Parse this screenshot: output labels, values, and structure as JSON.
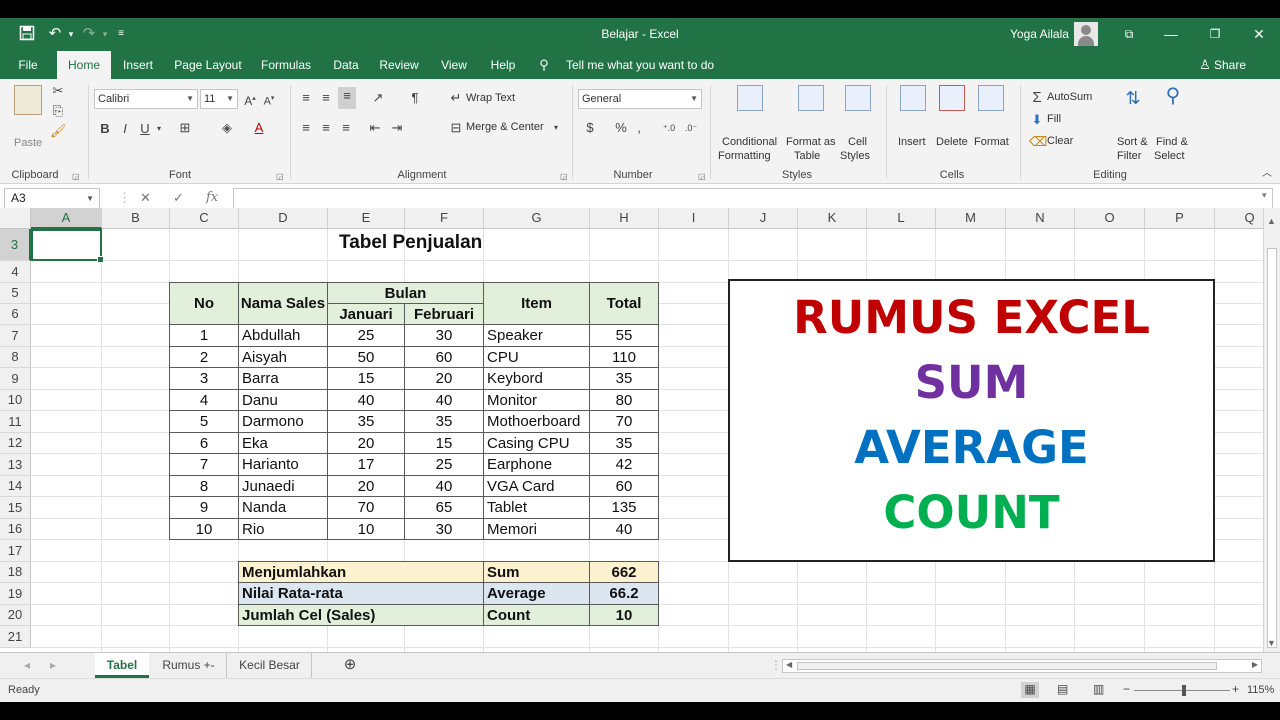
{
  "window": {
    "title": "Belajar  -  Excel",
    "user": "Yoga Ailala",
    "brand_color": "#217346"
  },
  "menu": {
    "tabs": [
      "File",
      "Home",
      "Insert",
      "Page Layout",
      "Formulas",
      "Data",
      "Review",
      "View",
      "Help"
    ],
    "active_tab": "Home",
    "tell_me": "Tell me what you want to do",
    "share": "Share"
  },
  "ribbon": {
    "clipboard": {
      "label": "Clipboard",
      "paste": "Paste"
    },
    "font": {
      "label": "Font",
      "name": "Calibri",
      "size": "11",
      "bold": "B",
      "italic": "I",
      "underline": "U"
    },
    "alignment": {
      "label": "Alignment",
      "wrap_text": "Wrap Text",
      "merge_center": "Merge & Center"
    },
    "number": {
      "label": "Number",
      "format": "General",
      "currency": "$",
      "percent": "%",
      "comma": ","
    },
    "styles": {
      "label": "Styles",
      "conditional_1": "Conditional",
      "conditional_2": "Formatting",
      "format_as_1": "Format as",
      "format_as_2": "Table",
      "cell_styles_1": "Cell",
      "cell_styles_2": "Styles"
    },
    "cells": {
      "label": "Cells",
      "insert": "Insert",
      "delete": "Delete",
      "format": "Format"
    },
    "editing": {
      "label": "Editing",
      "autosum": "AutoSum",
      "fill": "Fill",
      "clear": "Clear",
      "sort_1": "Sort &",
      "sort_2": "Filter",
      "find_1": "Find &",
      "find_2": "Select"
    }
  },
  "formula_bar": {
    "name_box": "A3",
    "formula": ""
  },
  "columns": [
    "A",
    "B",
    "C",
    "D",
    "E",
    "F",
    "G",
    "H",
    "I",
    "J",
    "K",
    "L",
    "M",
    "N",
    "O",
    "P",
    "Q"
  ],
  "rows": [
    "3",
    "4",
    "5",
    "6",
    "7",
    "8",
    "9",
    "10",
    "11",
    "12",
    "13",
    "14",
    "15",
    "16",
    "17",
    "18",
    "19",
    "20",
    "21"
  ],
  "selected_cell": "A3",
  "sheet": {
    "title": "Tabel Penjualan",
    "headers": {
      "no": "No",
      "nama": "Nama Sales",
      "bulan": "Bulan",
      "januari": "Januari",
      "februari": "Februari",
      "item": "Item",
      "total": "Total"
    },
    "table": [
      [
        "1",
        "Abdullah",
        "25",
        "30",
        "Speaker",
        "55"
      ],
      [
        "2",
        "Aisyah",
        "50",
        "60",
        "CPU",
        "110"
      ],
      [
        "3",
        "Barra",
        "15",
        "20",
        "Keybord",
        "35"
      ],
      [
        "4",
        "Danu",
        "40",
        "40",
        "Monitor",
        "80"
      ],
      [
        "5",
        "Darmono",
        "35",
        "35",
        "Mothoerboard",
        "70"
      ],
      [
        "6",
        "Eka",
        "20",
        "15",
        "Casing CPU",
        "35"
      ],
      [
        "7",
        "Harianto",
        "17",
        "25",
        "Earphone",
        "42"
      ],
      [
        "8",
        "Junaedi",
        "20",
        "40",
        "VGA Card",
        "60"
      ],
      [
        "9",
        "Nanda",
        "70",
        "65",
        "Tablet",
        "135"
      ],
      [
        "10",
        "Rio",
        "10",
        "30",
        "Memori",
        "40"
      ]
    ],
    "summary": [
      {
        "label": "Menjumlahkan",
        "func": "Sum",
        "value": "662",
        "color": "#fdf2d0"
      },
      {
        "label": "Nilai Rata-rata",
        "func": "Average",
        "value": "66.2",
        "color": "#dce6f1"
      },
      {
        "label": "Jumlah Cel (Sales)",
        "func": "Count",
        "value": "10",
        "color": "#e2efda"
      }
    ],
    "header_color": "#e2efda",
    "rumus_box": [
      {
        "text": "RUMUS EXCEL",
        "color": "#c00000"
      },
      {
        "text": "SUM",
        "color": "#7030a0"
      },
      {
        "text": "AVERAGE",
        "color": "#0070c0"
      },
      {
        "text": "COUNT",
        "color": "#00b050"
      }
    ]
  },
  "sheet_tabs": [
    "Tabel",
    "Rumus +-",
    "Kecil Besar"
  ],
  "active_sheet": "Tabel",
  "status": {
    "text": "Ready",
    "zoom": "115%"
  }
}
